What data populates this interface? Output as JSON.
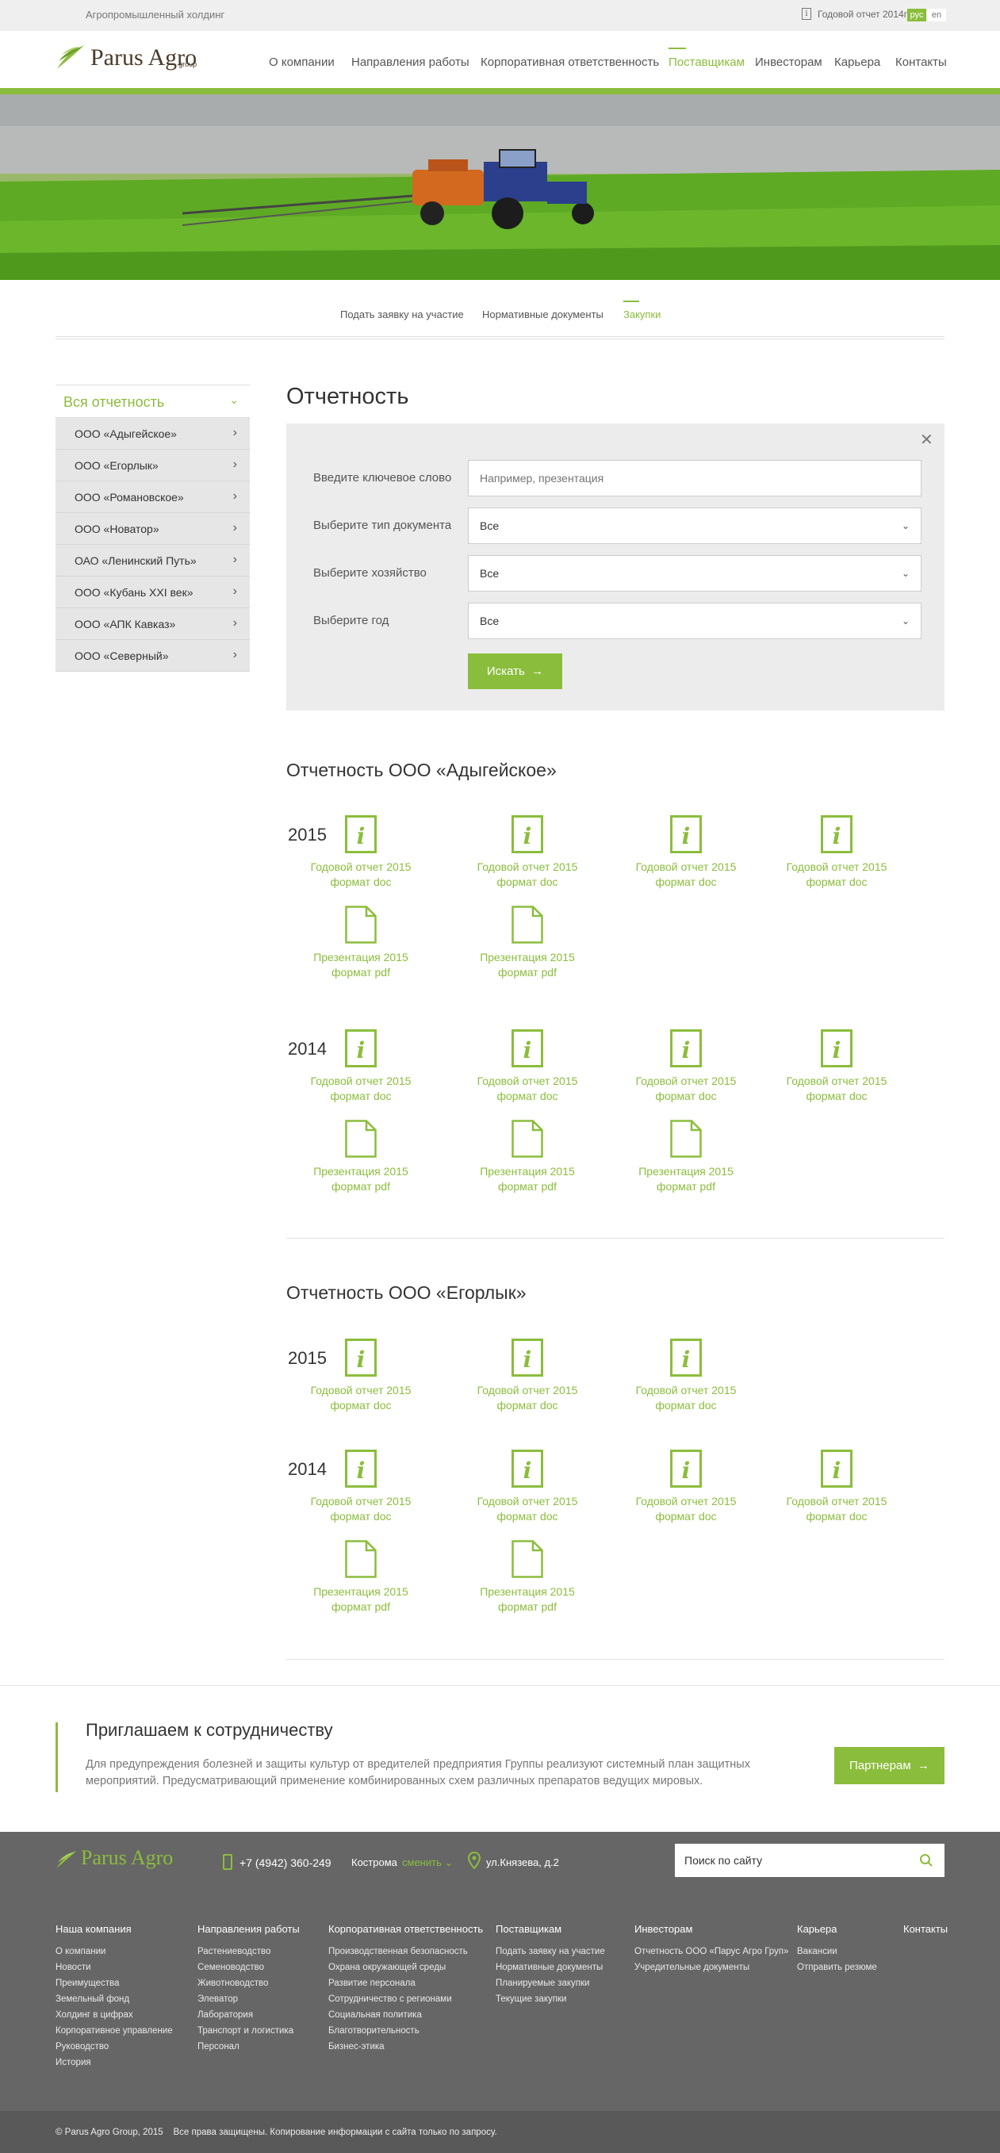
{
  "topbar": {
    "tagline": "Агропромышленный холдинг",
    "annual_report": "Годовой отчет 2014г",
    "langs": [
      "рус",
      "en"
    ]
  },
  "logo": {
    "text": "Parus Agro",
    "sub": "group"
  },
  "nav": [
    "О компании",
    "Направления работы",
    "Корпоративная ответственность",
    "Поставщикам",
    "Инвесторам",
    "Карьера",
    "Контакты"
  ],
  "subnav": [
    "Подать заявку на участие",
    "Нормативные документы",
    "Закупки"
  ],
  "sidebar": {
    "title": "Вся отчетность",
    "items": [
      "ООО «Адыгейское»",
      "ООО «Егорлык»",
      "ООО «Романовское»",
      "ООО «Новатор»",
      "ОАО «Ленинский Путь»",
      "ООО «Кубань XXI век»",
      "ООО «АПК Кавказ»",
      "ООО «Северный»"
    ]
  },
  "main": {
    "title": "Отчетность"
  },
  "filter": {
    "keyword_label": "Введите ключевое слово",
    "keyword_placeholder": "Например, презентация",
    "type_label": "Выберите тип документа",
    "type_value": "Все",
    "farm_label": "Выберите хозяйство",
    "farm_value": "Все",
    "year_label": "Выберите год",
    "year_value": "Все",
    "search_btn": "Искать"
  },
  "sections": [
    {
      "title": "Отчетность ООО «Адыгейское»",
      "groups": [
        {
          "year": "2015",
          "docs": [
            {
              "icon": "info-doc-icon",
              "name": "Годовой отчет 2015",
              "format": "формат doc"
            },
            {
              "icon": "info-doc-icon",
              "name": "Годовой отчет 2015",
              "format": "формат doc"
            },
            {
              "icon": "info-doc-icon",
              "name": "Годовой отчет 2015",
              "format": "формат doc"
            },
            {
              "icon": "info-doc-icon",
              "name": "Годовой отчет 2015",
              "format": "формат doc"
            },
            {
              "icon": "file-icon",
              "name": "Презентация 2015",
              "format": "формат pdf"
            },
            {
              "icon": "file-icon",
              "name": "Презентация 2015",
              "format": "формат pdf"
            }
          ]
        },
        {
          "year": "2014",
          "docs": [
            {
              "icon": "info-doc-icon",
              "name": "Годовой отчет 2015",
              "format": "формат doc"
            },
            {
              "icon": "info-doc-icon",
              "name": "Годовой отчет 2015",
              "format": "формат doc"
            },
            {
              "icon": "info-doc-icon",
              "name": "Годовой отчет 2015",
              "format": "формат doc"
            },
            {
              "icon": "info-doc-icon",
              "name": "Годовой отчет 2015",
              "format": "формат doc"
            },
            {
              "icon": "file-icon",
              "name": "Презентация 2015",
              "format": "формат pdf"
            },
            {
              "icon": "file-icon",
              "name": "Презентация 2015",
              "format": "формат pdf"
            },
            {
              "icon": "file-icon",
              "name": "Презентация 2015",
              "format": "формат pdf"
            }
          ]
        }
      ]
    },
    {
      "title": "Отчетность ООО «Егорлык»",
      "groups": [
        {
          "year": "2015",
          "docs": [
            {
              "icon": "info-doc-icon",
              "name": "Годовой отчет 2015",
              "format": "формат doc"
            },
            {
              "icon": "info-doc-icon",
              "name": "Годовой отчет 2015",
              "format": "формат doc"
            },
            {
              "icon": "info-doc-icon",
              "name": "Годовой отчет 2015",
              "format": "формат doc"
            }
          ]
        },
        {
          "year": "2014",
          "docs": [
            {
              "icon": "info-doc-icon",
              "name": "Годовой отчет 2015",
              "format": "формат doc"
            },
            {
              "icon": "info-doc-icon",
              "name": "Годовой отчет 2015",
              "format": "формат doc"
            },
            {
              "icon": "info-doc-icon",
              "name": "Годовой отчет 2015",
              "format": "формат doc"
            },
            {
              "icon": "info-doc-icon",
              "name": "Годовой отчет 2015",
              "format": "формат doc"
            },
            {
              "icon": "file-icon",
              "name": "Презентация 2015",
              "format": "формат pdf"
            },
            {
              "icon": "file-icon",
              "name": "Презентация 2015",
              "format": "формат pdf"
            }
          ]
        }
      ]
    }
  ],
  "invite": {
    "title": "Приглашаем к сотрудничеству",
    "text": "Для предупреждения болезней и защиты культур от вредителей предприятия Группы реализуют системный план защитных мероприятий. Предусматривающий применение комбинированных схем различных препаратов ведущих мировых.",
    "button": "Партнерам"
  },
  "footer": {
    "phone": "+7 (4942) 360-249",
    "city": "Кострома",
    "change": "сменить",
    "address": "ул.Князева, д.2",
    "search_placeholder": "Поиск по сайту",
    "columns": [
      {
        "title": "Наша компания",
        "items": [
          "О компании",
          "Новости",
          "Преимущества",
          "Земельный фонд",
          "Холдинг в цифрах",
          "Корпоративное управление",
          "Руководство",
          "История"
        ]
      },
      {
        "title": "Направления работы",
        "items": [
          "Растениеводство",
          "Семеноводство",
          "Животноводство",
          "Элеватор",
          "Лаборатория",
          "Транспорт и логистика",
          "Персонал"
        ]
      },
      {
        "title": "Корпоративная ответственность",
        "items": [
          "Производственная безопасность",
          "Охрана окружающей среды",
          "Развитие персонала",
          "Сотрудничество с регионами",
          "Социальная политика",
          "Благотворительность",
          "Бизнес-этика"
        ]
      },
      {
        "title": "Поставщикам",
        "items": [
          "Подать заявку на участие",
          "Нормативные документы",
          "Планируемые закупки",
          "Текущие закупки"
        ]
      },
      {
        "title": "Инвесторам",
        "items": [
          "Отчетность ООО «Парус Агро Груп»",
          "Учредительные документы"
        ]
      },
      {
        "title": "Карьера",
        "items": [
          "Вакансии",
          "Отправить резюме"
        ]
      },
      {
        "title": "Контакты",
        "items": []
      }
    ],
    "copyright": "© Parus Agro Group, 2015",
    "rights": "Все права защищены. Копирование информации с сайта  только по запросу."
  },
  "colors": {
    "accent": "#8bbd3c",
    "footer": "#666666"
  }
}
